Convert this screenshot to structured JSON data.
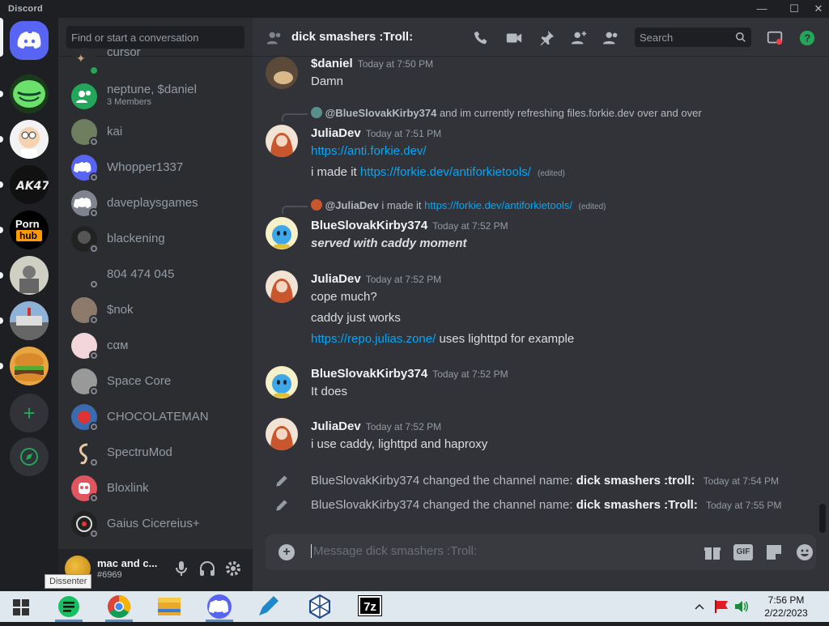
{
  "window": {
    "app_title": "Discord",
    "minimize": "—",
    "maximize": "☐",
    "close": "✕"
  },
  "dm": {
    "search_placeholder": "Find or start a conversation",
    "items": [
      {
        "name": "cursor",
        "status": "online"
      },
      {
        "name": "neptune, $daniel",
        "sub": "3 Members"
      },
      {
        "name": "kai",
        "status": "offline"
      },
      {
        "name": "Whopper1337",
        "status": "offline"
      },
      {
        "name": "daveplaysgames",
        "status": "offline"
      },
      {
        "name": "blackening",
        "status": "offline"
      },
      {
        "name": "804 474 045",
        "status": "offline"
      },
      {
        "name": "$nok",
        "status": "offline"
      },
      {
        "name": "cαм",
        "status": "offline"
      },
      {
        "name": "Space Core",
        "status": "offline"
      },
      {
        "name": "CHOCOLATEMAN",
        "status": "offline"
      },
      {
        "name": "SpectruMod",
        "status": "offline"
      },
      {
        "name": "Bloxlink",
        "status": "offline"
      },
      {
        "name": "Gaius Cicereius+",
        "status": "offline"
      }
    ]
  },
  "user": {
    "name": "mac and c...",
    "tag": "#6969"
  },
  "channel": {
    "title": "dick smashers :Troll:",
    "search_placeholder": "Search"
  },
  "messages": {
    "m1": {
      "author": "$daniel",
      "time": "Today at 7:50 PM",
      "text": "Damn"
    },
    "m2": {
      "reply_author": "@BlueSlovakKirby374",
      "reply_text": "and im currently refreshing files.forkie.dev over and over",
      "author": "JuliaDev",
      "time": "Today at 7:51 PM",
      "line1_link": "https://anti.forkie.dev/",
      "line2_text": "i made it",
      "line2_link": "https://forkie.dev/antiforkietools/",
      "edited": "(edited)"
    },
    "m3": {
      "reply_author": "@JuliaDev",
      "reply_text": "i made it",
      "reply_link": "https://forkie.dev/antiforkietools/",
      "reply_edited": "(edited)",
      "author": "BlueSlovakKirby374",
      "time": "Today at 7:52 PM",
      "text": "served with caddy moment"
    },
    "m4": {
      "author": "JuliaDev",
      "time": "Today at 7:52 PM",
      "line1": "cope much?",
      "line2": "caddy just works",
      "line3_link": "https://repo.julias.zone/",
      "line3_text": "uses lighttpd for example"
    },
    "m5": {
      "author": "BlueSlovakKirby374",
      "time": "Today at 7:52 PM",
      "text": "It does"
    },
    "m6": {
      "author": "JuliaDev",
      "time": "Today at 7:52 PM",
      "text": "i use caddy, lighttpd and haproxy"
    },
    "s1": {
      "author": "BlueSlovakKirby374",
      "action": "changed the channel name:",
      "name": "dick smashers :troll:",
      "time": "Today at 7:54 PM"
    },
    "s2": {
      "author": "BlueSlovakKirby374",
      "action": "changed the channel name:",
      "name": "dick smashers :Troll:",
      "time": "Today at 7:55 PM"
    }
  },
  "composer": {
    "placeholder": "Message dick smashers :Troll:",
    "gif": "GIF"
  },
  "taskbar": {
    "time": "7:56 PM",
    "date": "2/22/2023",
    "tooltip": "Dissenter",
    "sevenzip": "7z"
  },
  "colors": {
    "accent": "#5865f2",
    "link": "#00a8fc",
    "online": "#23a55a",
    "help": "#23a55a"
  }
}
